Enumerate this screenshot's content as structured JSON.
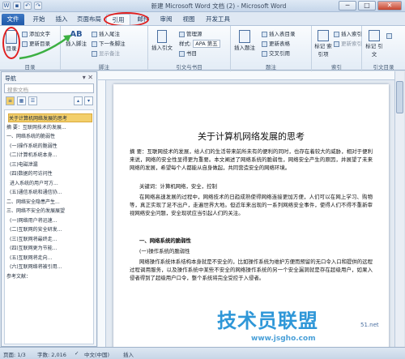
{
  "window": {
    "title": "新建 Microsoft Word 文档 (2) - Microsoft Word",
    "min": "─",
    "max": "□",
    "close": "✕"
  },
  "tabs": [
    "文件",
    "开始",
    "插入",
    "页面布局",
    "引用",
    "邮件",
    "审阅",
    "视图",
    "开发工具"
  ],
  "ribbon": {
    "toc": {
      "big": "目录",
      "add_text": "添加文字",
      "update": "更新目录",
      "label": "目录"
    },
    "footnote": {
      "insert": "插入脚注",
      "endnote": "插入尾注",
      "next": "下一条脚注",
      "show": "显示备注",
      "label": "脚注",
      "ab": "AB"
    },
    "citation": {
      "insert": "插入引文",
      "manage": "管理源",
      "style_label": "样式:",
      "style": "APA 第五",
      "bib": "书目",
      "label": "引文与书目"
    },
    "caption": {
      "insert": "插入题注",
      "table": "插入表目录",
      "update": "更新表格",
      "cross": "交叉引用",
      "label": "题注"
    },
    "index": {
      "mark": "标记\n索引项",
      "insert": "插入索引",
      "update": "更新索引",
      "label": "索引"
    },
    "toa": {
      "mark": "标记\n引文",
      "label": "引文目录"
    }
  },
  "nav": {
    "header": "导航",
    "search_placeholder": "搜索文档",
    "items": [
      "关于计算机网络发展的思考",
      "摘 要：互联网技术的发展...",
      "一、网络系统的脆弱性",
      "(一)操作系统的脆弱性",
      "(二)计算机系统本身...",
      "(三)电磁泄漏",
      "(四)数据的可访问性",
      "进入系统的用户可方...",
      "(五)通信系统和通信协...",
      "二、网络安全隐患产生...",
      "三、网络不安全的发展展望",
      "(一)网络用户将迅速...",
      "(二)互联网的安全研发...",
      "(三)互联网将最终走...",
      "(四)互联网更为节能...",
      "(五)互联网将走向...",
      "(六)互联网络将被引用...",
      "参考文献："
    ]
  },
  "doc": {
    "title": "关于计算机网络发展的思考",
    "abstract": "摘 要：互联网技术的发展，给人们的生活带来前所未有的便利的同时，也存在着较大的威胁，相对于便利来说，网络的安全性显得更为重要。本文阐述了网络系统的脆弱性，网络安全产生的原因，并展望了未来网络的发展，希望每个人都能从自身做起，共同营造安全的网络环境。",
    "keywords": "关键词：计算机网络，安全，控制",
    "p1": "在网络高速发展的过程中，网络技术的日趋成熟使得网络连接更加方便，人们可以在网上学习、购物等，真正实现了足不出户，走遍世界大地。但近年来出现的一系列网络安全事件，使得人们不得不重新审视网络安全问题，安全现状应当引起人们的关注。",
    "h1": "一、网络系统的脆弱性",
    "h2": "(一)操作系统的脆弱性",
    "p2": "网络操作系统体系结构本身就是不安全的，比如操作系统为维护方便而预留的无口令入口和提供的远程过程调用服务，以及操作系统中某些不安全的网络操作系统的另一个安全漏洞就是存在超级用户，如果入侵者得到了超级用户口令，整个系统将完全受控于入侵者。"
  },
  "status": {
    "page": "页面: 1/3",
    "words": "字数: 2,016",
    "lang": "中文(中国)",
    "mode": "插入"
  },
  "watermark": {
    "text": "技术员联盟",
    "url": "www.jsgho.com",
    "badge": "51.net"
  }
}
